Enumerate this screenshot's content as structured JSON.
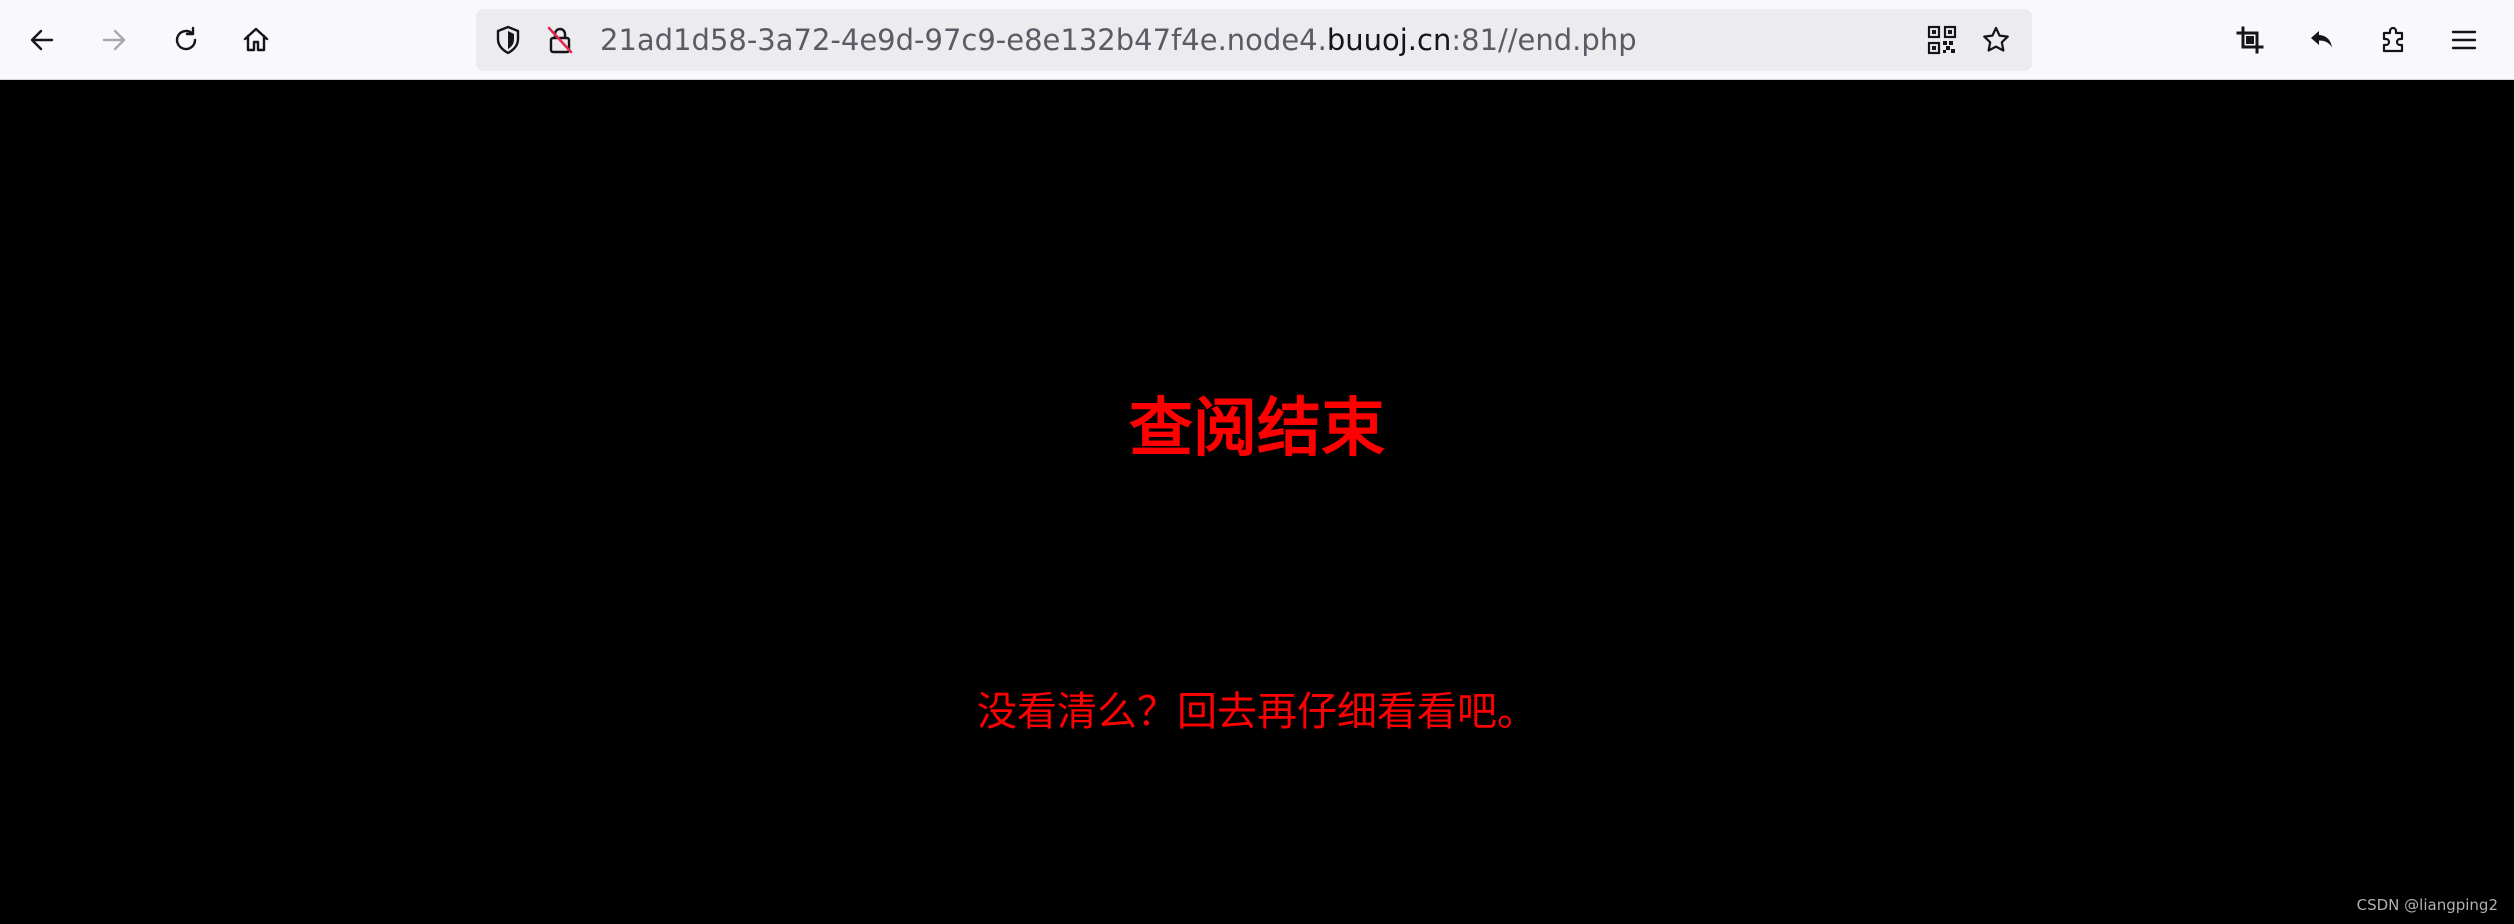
{
  "browser": {
    "url_prefix": "21ad1d58-3a72-4e9d-97c9-e8e132b47f4e.node4.",
    "url_domain": "buuoj.cn",
    "url_suffix": ":81//end.php",
    "icons": {
      "back": "back-arrow-icon",
      "forward": "forward-arrow-icon",
      "reload": "reload-icon",
      "home": "home-icon",
      "shield": "tracking-protection-shield-icon",
      "lock": "insecure-lock-icon",
      "qr": "qr-code-icon",
      "bookmark": "bookmark-star-icon",
      "screenshot": "crop-screenshot-icon",
      "undo": "back-reply-icon",
      "extensions": "extensions-puzzle-icon",
      "menu": "hamburger-menu-icon"
    }
  },
  "page": {
    "heading": "查阅结束",
    "message": "没看清么？回去再仔细看看吧。",
    "background_color": "#000000",
    "text_color": "#ff0000"
  },
  "watermark": "CSDN @liangping2"
}
